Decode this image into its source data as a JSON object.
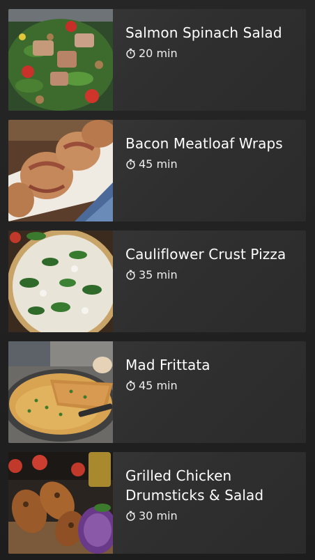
{
  "recipes": [
    {
      "title": "Salmon Spinach Salad",
      "time": "20 min",
      "image": "salmon-spinach-salad"
    },
    {
      "title": "Bacon Meatloaf Wraps",
      "time": "45 min",
      "image": "bacon-meatloaf-wraps"
    },
    {
      "title": "Cauliflower Crust Pizza",
      "time": "35 min",
      "image": "cauliflower-crust-pizza"
    },
    {
      "title": "Mad Frittata",
      "time": "45 min",
      "image": "mad-frittata"
    },
    {
      "title": "Grilled Chicken Drumsticks & Salad",
      "time": "30 min",
      "image": "grilled-chicken-drumsticks"
    }
  ],
  "icons": {
    "timer": "stopwatch-icon"
  },
  "colors": {
    "background": "#1f1f1f",
    "card": "#333333",
    "text": "#ffffff"
  }
}
